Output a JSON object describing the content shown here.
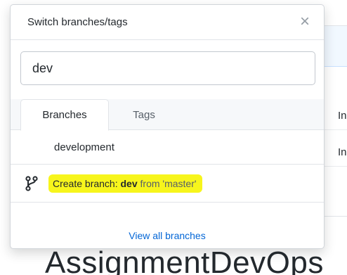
{
  "dropdown": {
    "title": "Switch branches/tags",
    "close_symbol": "×",
    "filter": {
      "value": "dev",
      "placeholder": ""
    },
    "tabs": [
      {
        "label": "Branches",
        "active": true
      },
      {
        "label": "Tags",
        "active": false
      }
    ],
    "branches": [
      {
        "name": "development"
      }
    ],
    "create_branch": {
      "prefix": "Create branch: ",
      "name": "dev",
      "suffix": " from 'master'",
      "icon": "git-branch-icon",
      "highlight_color": "#f7f51c"
    },
    "footer_link": "View all branches"
  },
  "background": {
    "rows": [
      "In",
      "In"
    ],
    "repo_title": "AssignmentDevOps"
  },
  "colors": {
    "link": "#0366d6",
    "border": "#e1e4e8",
    "text": "#24292e"
  }
}
